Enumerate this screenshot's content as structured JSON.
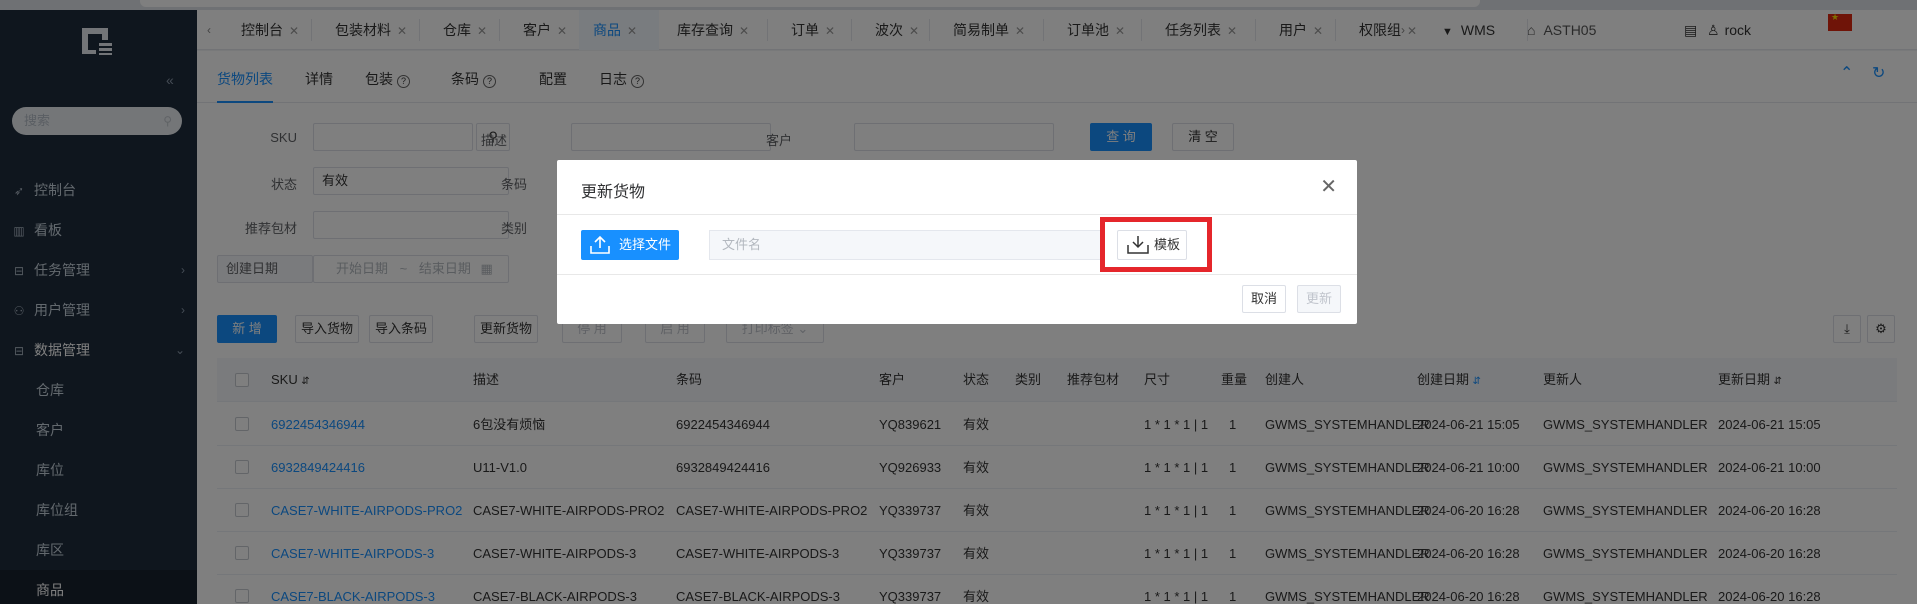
{
  "sidebar": {
    "search_placeholder": "搜索",
    "items": [
      {
        "label": "控制台",
        "icon": "rocket-icon"
      },
      {
        "label": "看板",
        "icon": "bar-chart-icon"
      },
      {
        "label": "任务管理",
        "icon": "lock-icon"
      },
      {
        "label": "用户管理",
        "icon": "users-icon"
      },
      {
        "label": "数据管理",
        "icon": "lock-icon"
      }
    ],
    "sub_items": [
      "仓库",
      "客户",
      "库位",
      "库位组",
      "库区",
      "商品"
    ],
    "active_sub": "商品"
  },
  "tabs": [
    "控制台",
    "包装材料",
    "仓库",
    "客户",
    "商品",
    "库存查询",
    "订单",
    "波次",
    "简易制单",
    "订单池",
    "任务列表",
    "用户",
    "权限组"
  ],
  "active_tab": "商品",
  "topbar": {
    "app": "WMS",
    "warehouse": "ASTH05",
    "user": "rock"
  },
  "subtabs": [
    "货物列表",
    "详情",
    "包装",
    "条码",
    "配置",
    "日志"
  ],
  "filters": {
    "sku_label": "SKU",
    "desc_label": "描述",
    "customer_label": "客户",
    "query_button": "查 询",
    "clear_button": "清 空",
    "status_label": "状态",
    "status_value": "有效",
    "barcode_label": "条码",
    "pkg_label": "推荐包材",
    "category_label": "类别",
    "date_label": "创建日期",
    "start_date": "开始日期",
    "date_sep": "~",
    "end_date": "结束日期"
  },
  "toolbar": {
    "add": "新 增",
    "import_goods": "导入货物",
    "import_barcode": "导入条码",
    "update_goods": "更新货物",
    "disable": "停 用",
    "enable": "启 用",
    "print": "打印标签"
  },
  "table": {
    "headers": [
      "SKU",
      "描述",
      "条码",
      "客户",
      "状态",
      "类别",
      "推荐包材",
      "尺寸",
      "重量",
      "创建人",
      "创建日期",
      "更新人",
      "更新日期"
    ],
    "rows": [
      [
        "6922454346944",
        "6包没有烦恼",
        "6922454346944",
        "YQ839621",
        "有效",
        "",
        "",
        "1 * 1 * 1 | 1",
        "1",
        "GWMS_SYSTEMHANDLER",
        "2024-06-21 15:05",
        "GWMS_SYSTEMHANDLER",
        "2024-06-21 15:05"
      ],
      [
        "6932849424416",
        "U11-V1.0",
        "6932849424416",
        "YQ926933",
        "有效",
        "",
        "",
        "1 * 1 * 1 | 1",
        "1",
        "GWMS_SYSTEMHANDLER",
        "2024-06-21 10:00",
        "GWMS_SYSTEMHANDLER",
        "2024-06-21 10:00"
      ],
      [
        "CASE7-WHITE-AIRPODS-PRO2",
        "CASE7-WHITE-AIRPODS-PRO2",
        "CASE7-WHITE-AIRPODS-PRO2",
        "YQ339737",
        "有效",
        "",
        "",
        "1 * 1 * 1 | 1",
        "1",
        "GWMS_SYSTEMHANDLER",
        "2024-06-20 16:28",
        "GWMS_SYSTEMHANDLER",
        "2024-06-20 16:28"
      ],
      [
        "CASE7-WHITE-AIRPODS-3",
        "CASE7-WHITE-AIRPODS-3",
        "CASE7-WHITE-AIRPODS-3",
        "YQ339737",
        "有效",
        "",
        "",
        "1 * 1 * 1 | 1",
        "1",
        "GWMS_SYSTEMHANDLER",
        "2024-06-20 16:28",
        "GWMS_SYSTEMHANDLER",
        "2024-06-20 16:28"
      ],
      [
        "CASE7-BLACK-AIRPODS-3",
        "CASE7-BLACK-AIRPODS-3",
        "CASE7-BLACK-AIRPODS-3",
        "YQ339737",
        "有效",
        "",
        "",
        "1 * 1 * 1 | 1",
        "1",
        "GWMS_SYSTEMHANDLER",
        "2024-06-20 16:28",
        "GWMS_SYSTEMHANDLER",
        "2024-06-20 16:28"
      ]
    ]
  },
  "modal": {
    "title": "更新货物",
    "select_file": "选择文件",
    "file_placeholder": "文件名",
    "template": "模板",
    "cancel": "取消",
    "update": "更新"
  },
  "colors": {
    "primary": "#1890ff",
    "sidebar_bg": "#1f2d3d",
    "highlight": "#e5262b"
  }
}
